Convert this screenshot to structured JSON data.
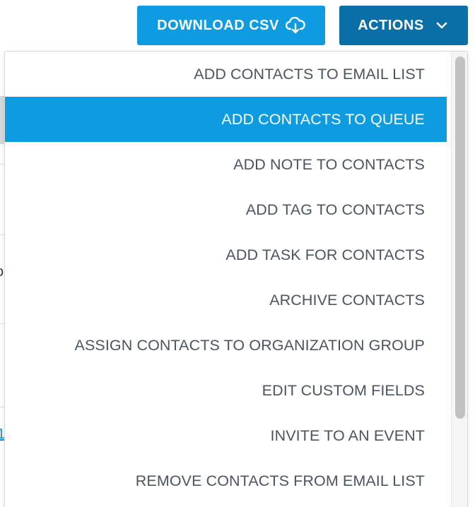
{
  "toolbar": {
    "download_csv_label": "DOWNLOAD CSV",
    "download_icon": "cloud-download-icon",
    "actions_label": "ACTIONS",
    "actions_icon": "chevron-down-icon",
    "csv_color": "#0f9be0",
    "actions_color": "#0a6fa6"
  },
  "background": {
    "row_fragment": "o",
    "link_fragment": "1"
  },
  "menu": {
    "items": [
      {
        "label": "ADD CONTACTS TO EMAIL LIST",
        "active": false
      },
      {
        "label": "ADD CONTACTS TO QUEUE",
        "active": true
      },
      {
        "label": "ADD NOTE TO CONTACTS",
        "active": false
      },
      {
        "label": "ADD TAG TO CONTACTS",
        "active": false
      },
      {
        "label": "ADD TASK FOR CONTACTS",
        "active": false
      },
      {
        "label": "ARCHIVE CONTACTS",
        "active": false
      },
      {
        "label": "ASSIGN CONTACTS TO ORGANIZATION GROUP",
        "active": false
      },
      {
        "label": "EDIT CUSTOM FIELDS",
        "active": false
      },
      {
        "label": "INVITE TO AN EVENT",
        "active": false
      },
      {
        "label": "REMOVE CONTACTS FROM EMAIL LIST",
        "active": false
      }
    ],
    "highlight_color": "#0f9be0",
    "text_color": "#4a5560"
  }
}
